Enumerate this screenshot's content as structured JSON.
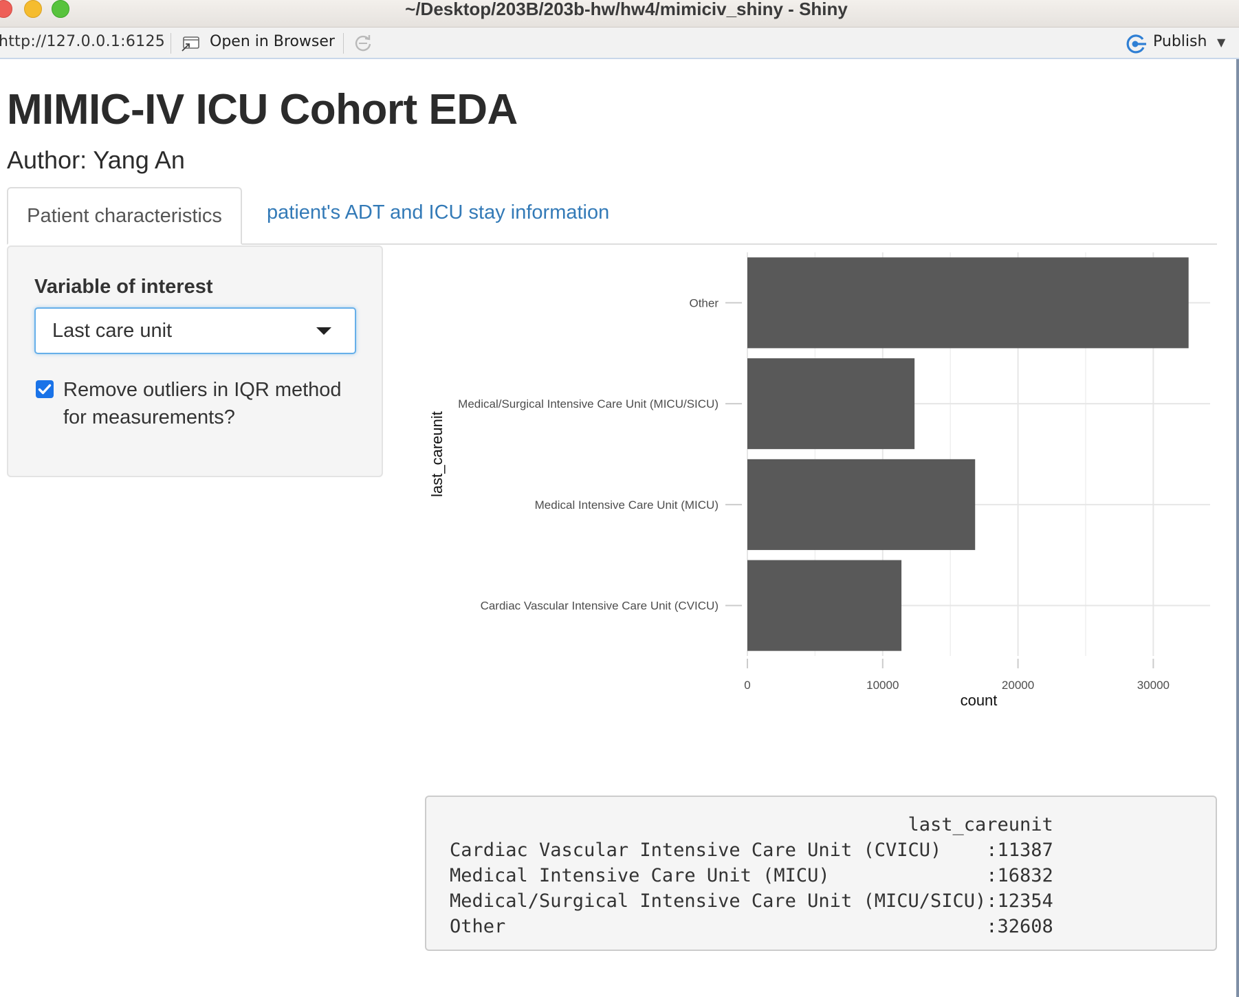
{
  "window": {
    "title": "~/Desktop/203B/203b-hw/hw4/mimiciv_shiny - Shiny"
  },
  "toolbar": {
    "url": "http://127.0.0.1:6125",
    "open_in_browser_label": "Open in Browser",
    "publish_label": "Publish"
  },
  "page": {
    "title": "MIMIC-IV ICU Cohort EDA",
    "subtitle": "Author: Yang An"
  },
  "tabs": [
    {
      "label": "Patient characteristics",
      "active": true
    },
    {
      "label": "patient's ADT and ICU stay information",
      "active": false
    }
  ],
  "sidebar": {
    "variable_label": "Variable of interest",
    "variable_selected": "Last care unit",
    "outlier_checkbox_label": "Remove outliers in IQR method for measurements?",
    "outlier_checked": true
  },
  "chart_data": {
    "type": "bar",
    "orientation": "horizontal",
    "categories": [
      "Cardiac Vascular Intensive Care Unit (CVICU)",
      "Medical Intensive Care Unit (MICU)",
      "Medical/Surgical Intensive Care Unit (MICU/SICU)",
      "Other"
    ],
    "values": [
      11387,
      16832,
      12354,
      32608
    ],
    "xlabel": "count",
    "ylabel": "last_careunit",
    "xticks": [
      0,
      10000,
      20000,
      30000
    ],
    "xlim": [
      0,
      34200
    ],
    "grid": true,
    "bar_color": "#595959"
  },
  "summary": {
    "header": "last_careunit",
    "rows": [
      {
        "label": "Cardiac Vascular Intensive Care Unit (CVICU)",
        "value": "11387"
      },
      {
        "label": "Medical Intensive Care Unit (MICU)",
        "value": "16832"
      },
      {
        "label": "Medical/Surgical Intensive Care Unit (MICU/SICU)",
        "value": "12354"
      },
      {
        "label": "Other",
        "value": "32608"
      }
    ]
  },
  "colors": {
    "link": "#337ab7",
    "focus_border": "#66afe9",
    "checkbox": "#1a73e8"
  },
  "icons": [
    "open-in-browser-icon",
    "refresh-icon",
    "publish-icon"
  ]
}
